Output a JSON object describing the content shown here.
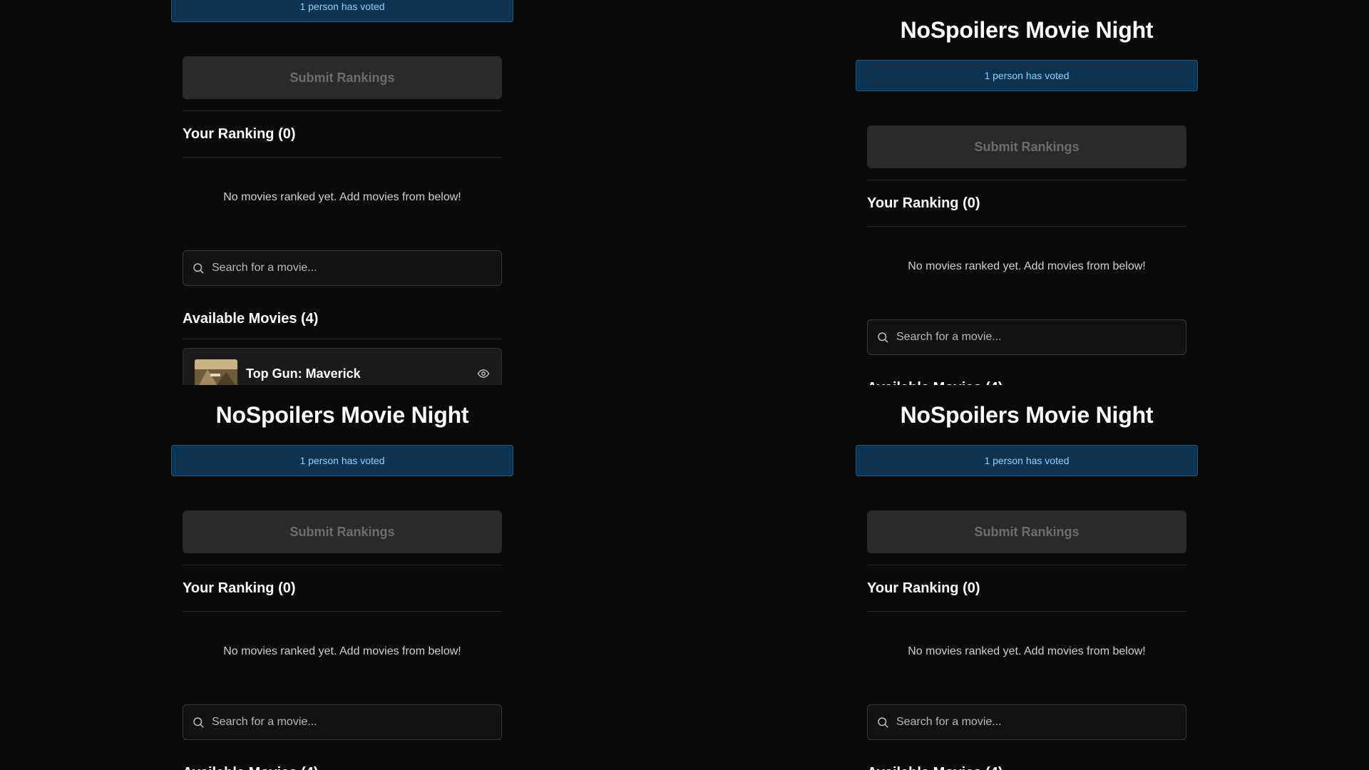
{
  "app": {
    "title": "NoSpoilers Movie Night",
    "vote_status": "1 person has voted"
  },
  "actions": {
    "submit_label": "Submit Rankings"
  },
  "ranking": {
    "heading": "Your Ranking (0)",
    "empty_message": "No movies ranked yet. Add movies from below!"
  },
  "search": {
    "placeholder": "Search for a movie..."
  },
  "available": {
    "heading": "Available Movies (4)",
    "movies": [
      {
        "title": "Top Gun: Maverick"
      }
    ]
  },
  "colors": {
    "background": "#0a0a0a",
    "banner_bg": "#0c3352",
    "banner_border": "#1d5a8a",
    "banner_text": "#8fd0ff",
    "button_disabled_bg": "#2a2a2a",
    "button_disabled_text": "#6d6d6d"
  },
  "icons": {
    "search": "search-icon",
    "visibility": "eye-icon"
  }
}
